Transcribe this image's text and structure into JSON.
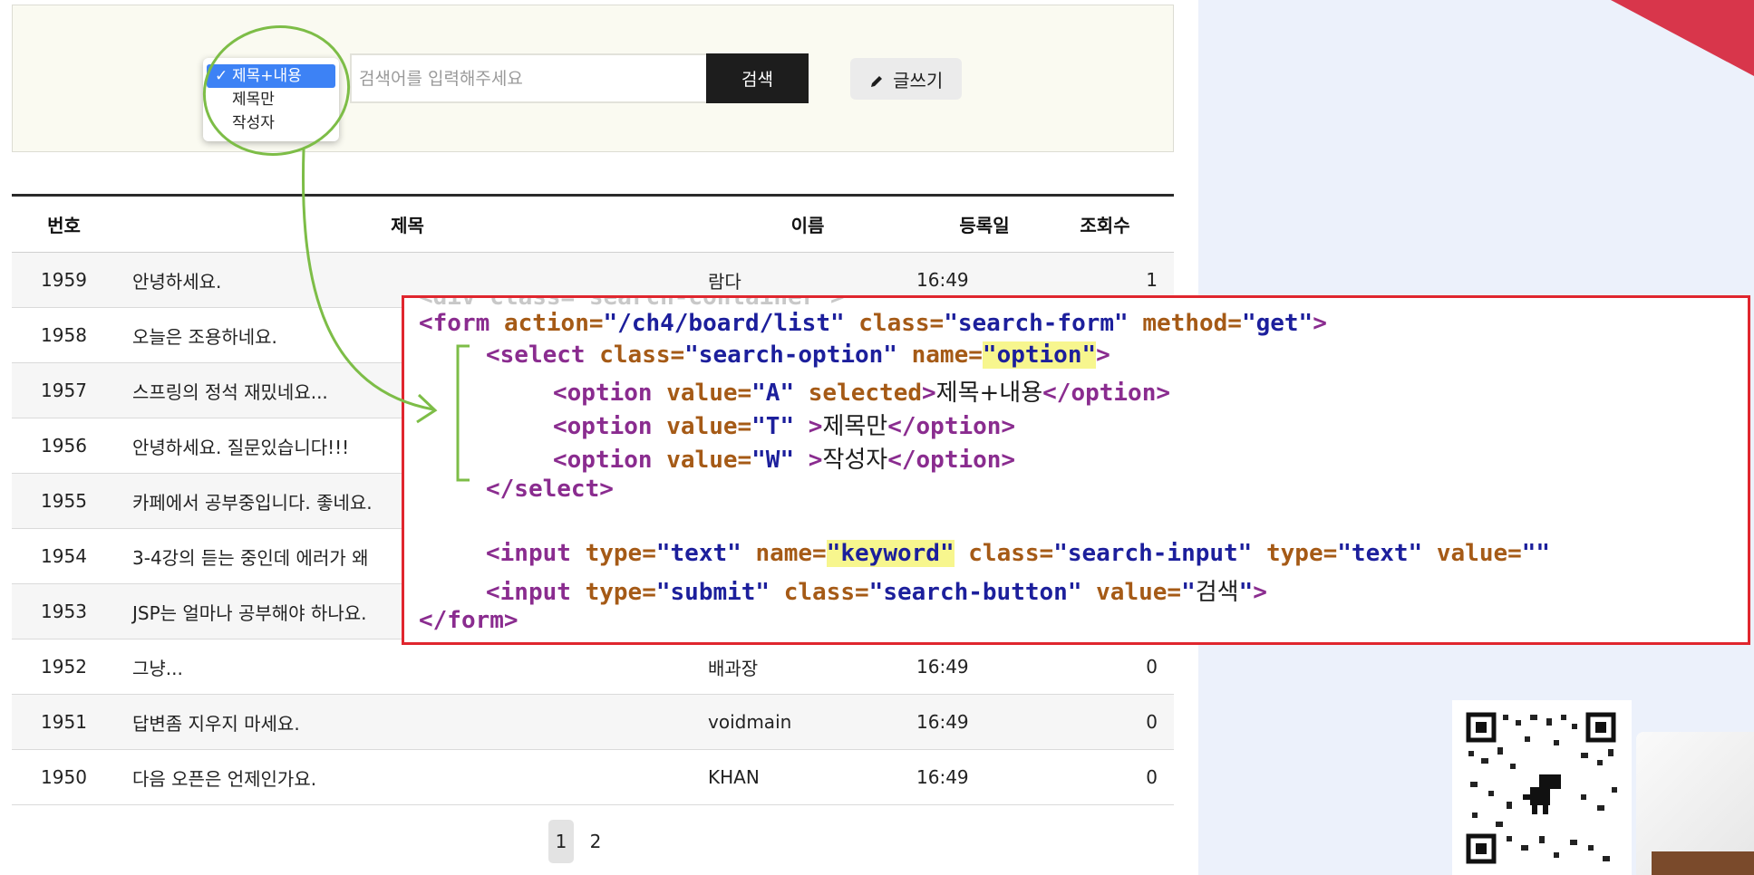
{
  "search": {
    "options": [
      {
        "label": "제목+내용",
        "selected": true
      },
      {
        "label": "제목만",
        "selected": false
      },
      {
        "label": "작성자",
        "selected": false
      }
    ],
    "check_mark": "✓",
    "placeholder": "검색어를 입력해주세요",
    "button_label": "검색",
    "write_label": "글쓰기"
  },
  "table": {
    "headers": {
      "num": "번호",
      "title": "제목",
      "name": "이름",
      "date": "등록일",
      "views": "조회수"
    },
    "rows": [
      {
        "num": "1959",
        "title": "안녕하세요.",
        "name": "람다",
        "date": "16:49",
        "views": "1"
      },
      {
        "num": "1958",
        "title": "오늘은 조용하네요.",
        "name": "",
        "date": "",
        "views": ""
      },
      {
        "num": "1957",
        "title": "스프링의 정석 재밌네요...",
        "name": "",
        "date": "",
        "views": ""
      },
      {
        "num": "1956",
        "title": "안녕하세요. 질문있습니다!!!",
        "name": "",
        "date": "",
        "views": ""
      },
      {
        "num": "1955",
        "title": "카페에서 공부중입니다. 좋네요.",
        "name": "",
        "date": "",
        "views": ""
      },
      {
        "num": "1954",
        "title": "3-4강의 듣는 중인데 에러가 왜",
        "name": "",
        "date": "",
        "views": ""
      },
      {
        "num": "1953",
        "title": "JSP는 얼마나 공부해야 하나요.",
        "name": "",
        "date": "",
        "views": ""
      },
      {
        "num": "1952",
        "title": "그냥...",
        "name": "배과장",
        "date": "16:49",
        "views": "0"
      },
      {
        "num": "1951",
        "title": "답변좀 지우지 마세요.",
        "name": "voidmain",
        "date": "16:49",
        "views": "0"
      },
      {
        "num": "1950",
        "title": "다음 오픈은 언제인가요.",
        "name": "KHAN",
        "date": "16:49",
        "views": "0"
      }
    ]
  },
  "pagination": {
    "pages": [
      "1",
      "2"
    ],
    "active": "1"
  },
  "code": {
    "top_fragment": "<div class=\"search-container\">",
    "form_open": {
      "tag": "<form",
      "action_attr": "action=",
      "action_val": "\"/ch4/board/list\"",
      "class_attr": "class=",
      "class_val": "\"search-form\"",
      "method_attr": "method=",
      "method_val": "\"get\"",
      "close": ">"
    },
    "select_open": {
      "tag": "<select",
      "class_attr": "class=",
      "class_val": "\"search-option\"",
      "name_attr": "name=",
      "name_q1": "\"",
      "name_val": "option",
      "name_q2": "\"",
      "close": ">"
    },
    "options": [
      {
        "open": "<option",
        "attr": "value=",
        "val": "\"A\"",
        "extra": " selected",
        "close": ">",
        "text": "제목+내용",
        "end": "</option>"
      },
      {
        "open": "<option",
        "attr": "value=",
        "val": "\"T\"",
        "extra": " ",
        "close": ">",
        "text": "제목만",
        "end": "</option>"
      },
      {
        "open": "<option",
        "attr": "value=",
        "val": "\"W\"",
        "extra": " ",
        "close": ">",
        "text": "작성자",
        "end": "</option>"
      }
    ],
    "select_close": "</select>",
    "input_text": {
      "tag": "<input",
      "type_attr": "type=",
      "type_val": "\"text\"",
      "name_attr": "name=",
      "name_q1": "\"",
      "name_val": "keyword",
      "name_q2": "\"",
      "class_attr": "class=",
      "class_val": "\"search-input\"",
      "type2_attr": "type=",
      "type2_val": "\"text\"",
      "value_attr": "value=",
      "value_val": "\"\""
    },
    "input_submit": {
      "tag": "<input",
      "type_attr": "type=",
      "type_val": "\"submit\"",
      "class_attr": "class=",
      "class_val": "\"search-button\"",
      "value_attr": "value=",
      "value_q1": "\"",
      "value_text": "검색",
      "value_q2": "\"",
      "close": ">"
    },
    "form_close": "</form>"
  },
  "colors": {
    "tag": "#8a2c8f",
    "attribute": "#a55a16",
    "value": "#1c1f9c",
    "highlight": "#f7f68e",
    "frame": "#e0262e",
    "annotation": "#7dbd47",
    "accent": "#d8364b"
  },
  "icons": {
    "write": "pencil-icon",
    "qr": "qr-code",
    "mascot": "dinosaur-icon"
  }
}
